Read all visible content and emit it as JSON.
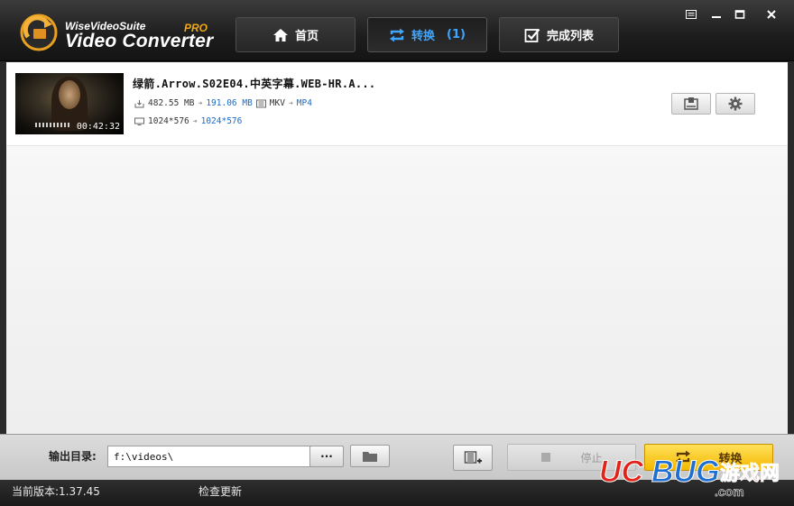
{
  "app": {
    "brand_small": "WiseVideoSuite",
    "brand_big": "Video Converter",
    "brand_pro": "PRO"
  },
  "tabs": [
    {
      "label": "首页",
      "icon": "home-icon"
    },
    {
      "label": "转换",
      "count": "(1)",
      "icon": "convert-icon",
      "active": true
    },
    {
      "label": "完成列表",
      "icon": "checklist-icon"
    }
  ],
  "window_controls": [
    "menu-icon",
    "minimize-icon",
    "maximize-icon",
    "close-icon"
  ],
  "file": {
    "title": "绿箭.Arrow.S02E04.中英字幕.WEB-HR.A...",
    "duration": "00:42:32",
    "size_from": "482.55 MB",
    "size_to": "191.06 MB",
    "format_from": "MKV",
    "format_to": "MP4",
    "res_from": "1024*576",
    "res_to": "1024*576"
  },
  "output": {
    "label": "输出目录:",
    "path": "f:\\videos\\",
    "browse_label": "···"
  },
  "actions": {
    "stop_label": "停止",
    "convert_label": "转换"
  },
  "status": {
    "version": "当前版本:1.37.45",
    "check_update": "检查更新"
  },
  "colors": {
    "accent_blue": "#3fa6ff",
    "convert_yellow": "#f4b800",
    "title_bar": "#1d1d1d"
  },
  "watermark": {
    "text": "UCBUG游戏网",
    "domain": ".com"
  }
}
